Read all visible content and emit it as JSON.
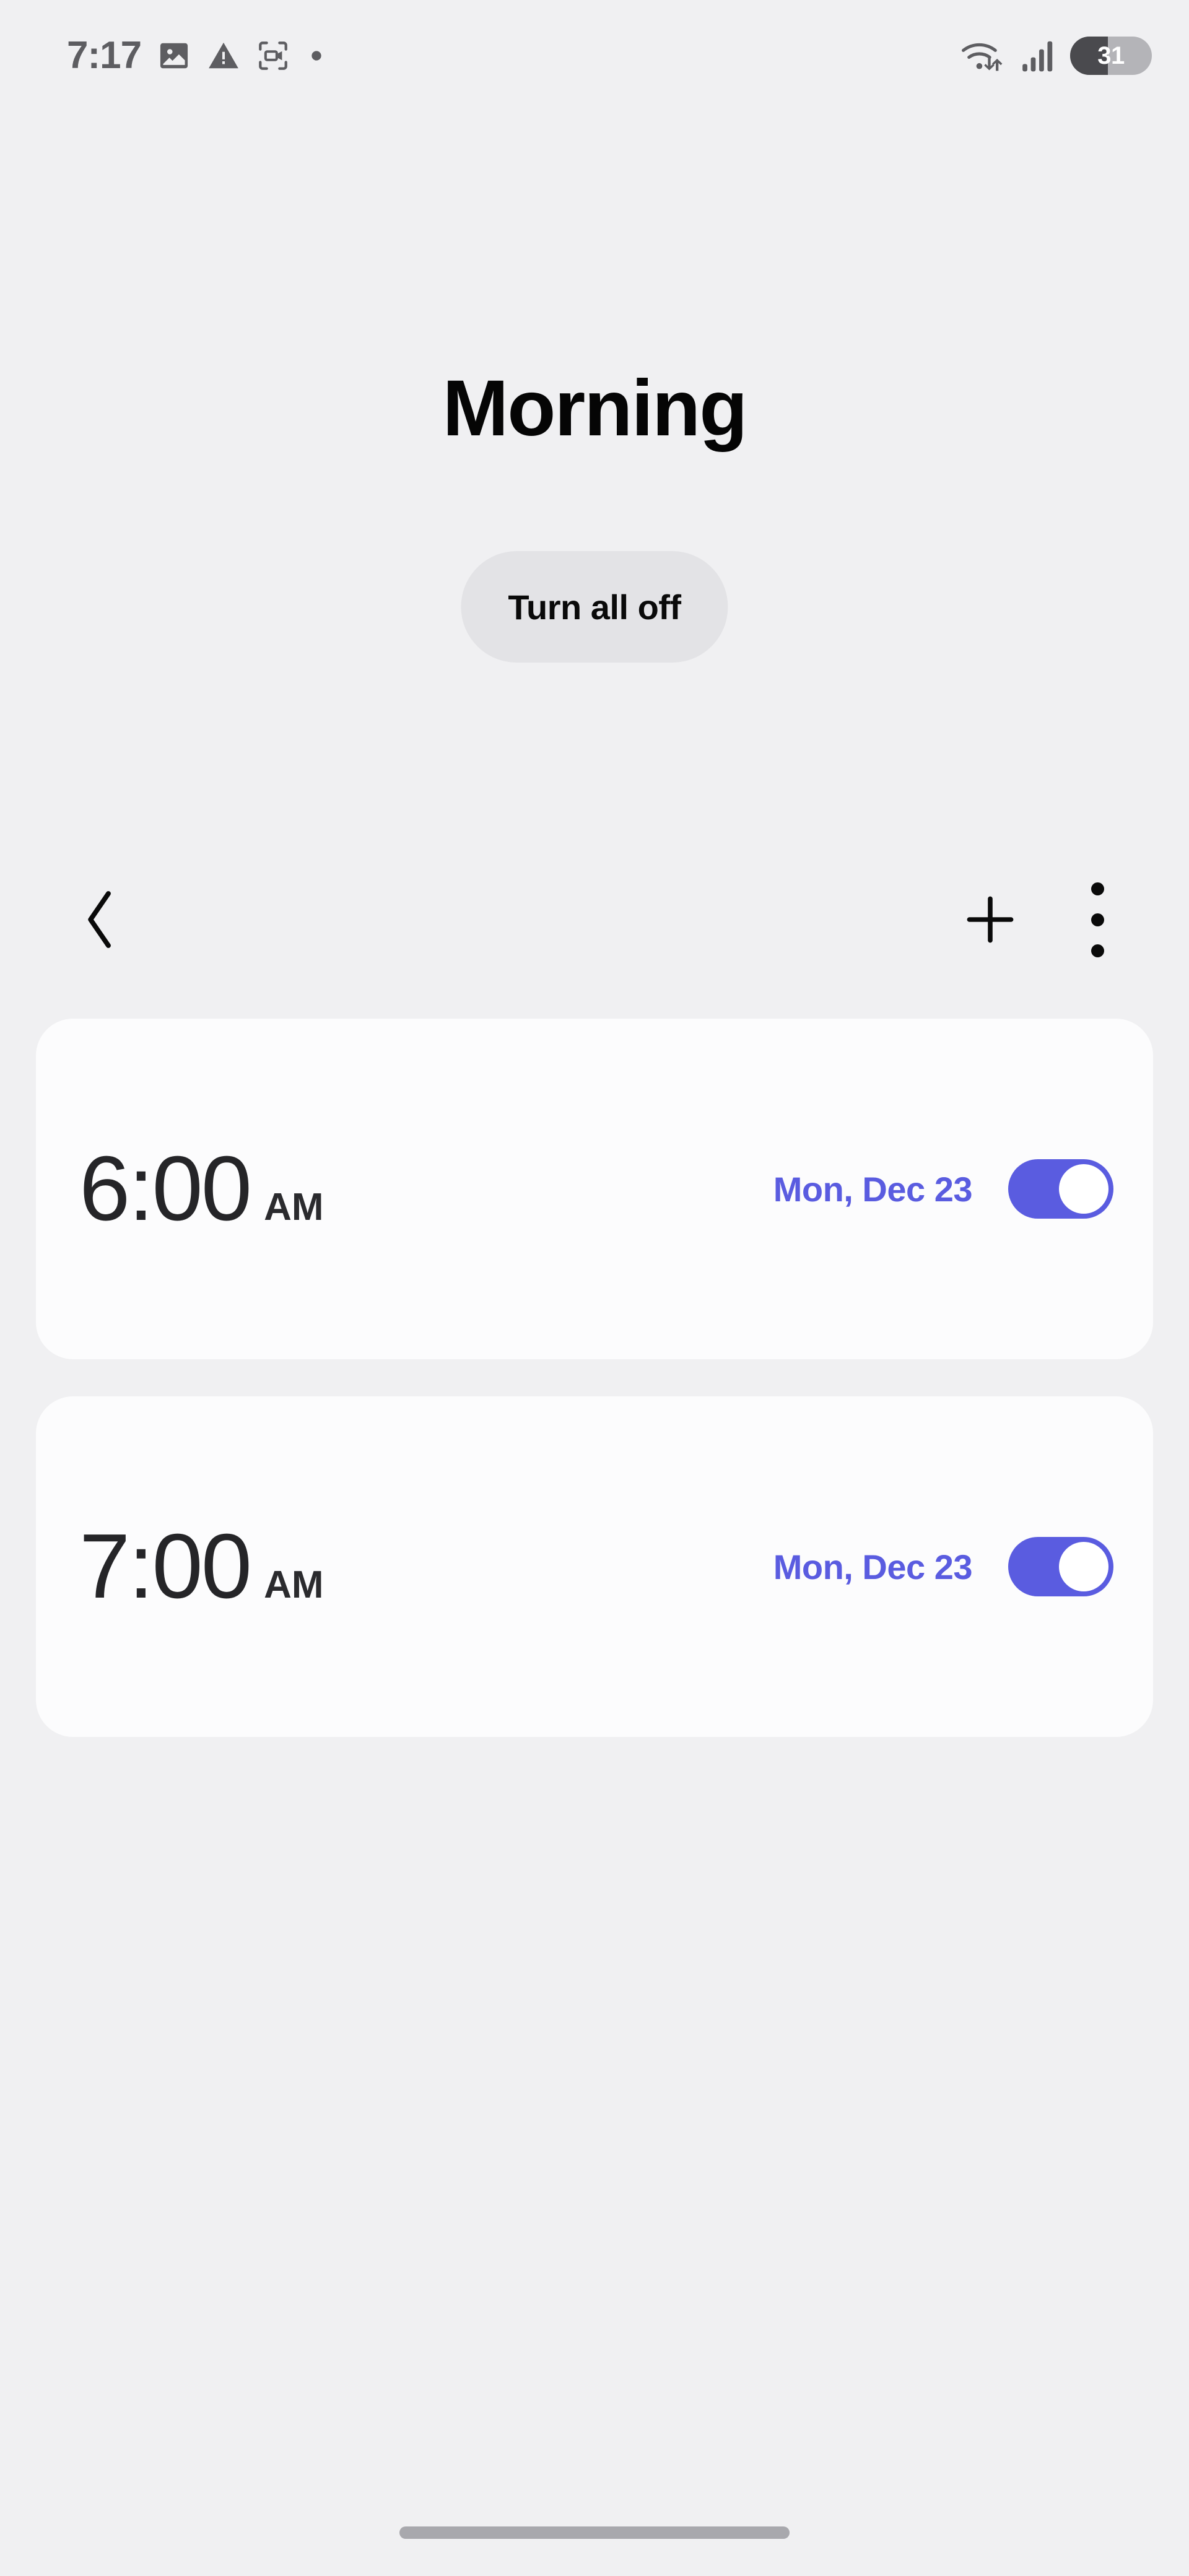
{
  "status_bar": {
    "time": "7:17",
    "left_icons": [
      "image-icon",
      "warning-triangle-icon",
      "screen-record-icon",
      "dot-indicator-icon"
    ],
    "right_icons": [
      "wifi-data-icon",
      "cellular-signal-icon"
    ],
    "battery_level": "31"
  },
  "header": {
    "title": "Morning",
    "turn_all_off_label": "Turn all off"
  },
  "toolbar": {
    "back_icon": "chevron-left-icon",
    "add_icon": "plus-icon",
    "menu_icon": "more-vertical-icon"
  },
  "alarms": [
    {
      "time": "6:00",
      "period": "AM",
      "date": "Mon, Dec 23",
      "enabled": true
    },
    {
      "time": "7:00",
      "period": "AM",
      "date": "Mon, Dec 23",
      "enabled": true
    }
  ],
  "colors": {
    "accent": "#5a5ce0",
    "page_background": "#f0f0f2",
    "card_background": "#fcfcfd",
    "pill_background": "#e3e3e6"
  }
}
